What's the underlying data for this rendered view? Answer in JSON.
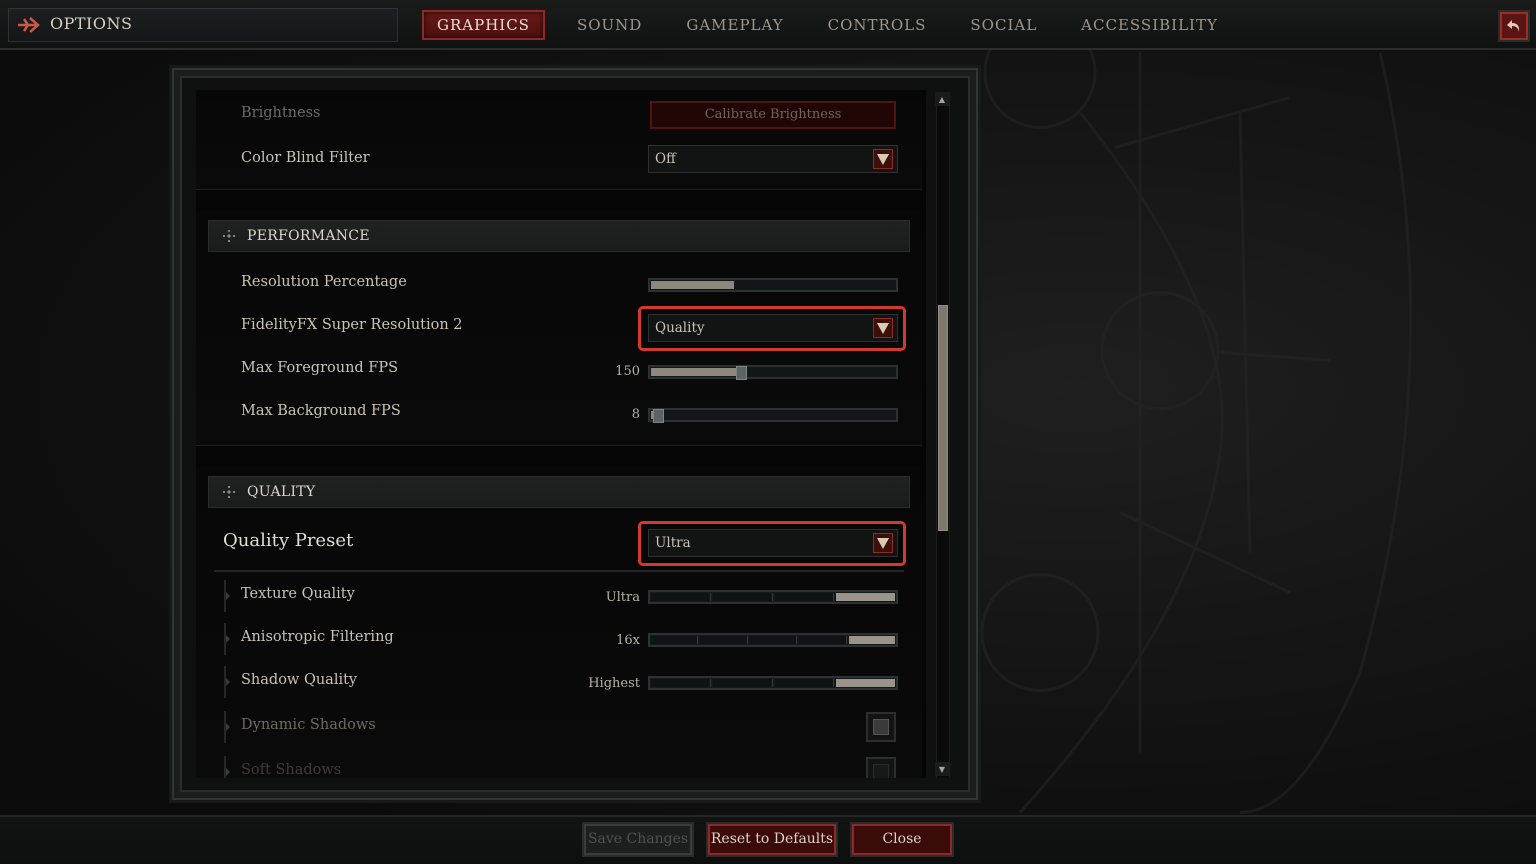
{
  "header": {
    "title": "OPTIONS",
    "tabs": [
      {
        "label": "GRAPHICS",
        "active": true
      },
      {
        "label": "SOUND",
        "active": false
      },
      {
        "label": "GAMEPLAY",
        "active": false
      },
      {
        "label": "CONTROLS",
        "active": false
      },
      {
        "label": "SOCIAL",
        "active": false
      },
      {
        "label": "ACCESSIBILITY",
        "active": false
      }
    ],
    "back_icon": "back-arrow-icon"
  },
  "display": {
    "brightness": {
      "label": "Brightness",
      "button": "Calibrate Brightness"
    },
    "color_blind": {
      "label": "Color Blind Filter",
      "value": "Off"
    }
  },
  "performance": {
    "title": "PERFORMANCE",
    "resolution_percentage": {
      "label": "Resolution Percentage",
      "fill_fraction": 0.34
    },
    "fsr2": {
      "label": "FidelityFX Super Resolution 2",
      "value": "Quality"
    },
    "max_fg_fps": {
      "label": "Max Foreground FPS",
      "value": "150",
      "fill_fraction": 0.36
    },
    "max_bg_fps": {
      "label": "Max Background FPS",
      "value": "8",
      "fill_fraction": 0.02
    }
  },
  "quality": {
    "title": "QUALITY",
    "preset": {
      "label": "Quality Preset",
      "value": "Ultra"
    },
    "items": [
      {
        "label": "Texture Quality",
        "value": "Ultra",
        "segments": 4,
        "selected": 4
      },
      {
        "label": "Anisotropic Filtering",
        "value": "16x",
        "segments": 5,
        "selected": 5
      },
      {
        "label": "Shadow Quality",
        "value": "Highest",
        "segments": 4,
        "selected": 4
      },
      {
        "label": "Dynamic Shadows",
        "checked": true
      },
      {
        "label": "Soft Shadows",
        "checked": false
      }
    ]
  },
  "footer": {
    "save": "Save Changes",
    "reset": "Reset to Defaults",
    "close": "Close"
  },
  "colors": {
    "accent_red": "#8d2a24",
    "highlight_red": "#d23b2c",
    "text": "#c9c2b6"
  }
}
